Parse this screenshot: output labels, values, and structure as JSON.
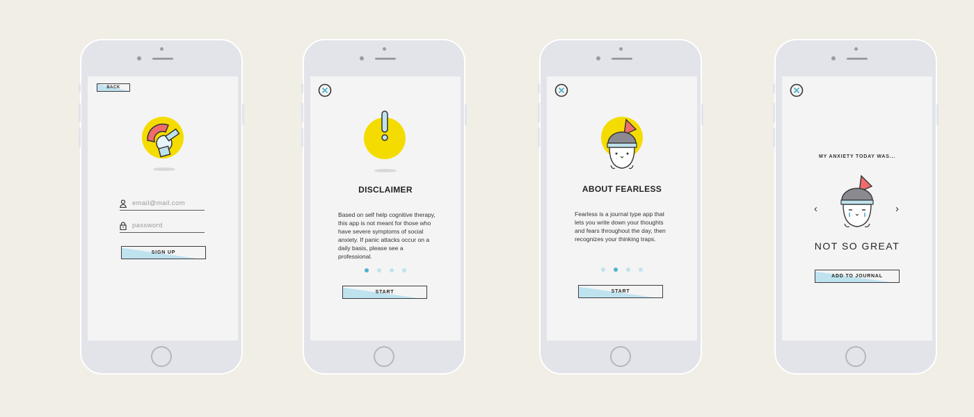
{
  "screens": [
    {
      "id": "login",
      "back_label": "BACK",
      "email_placeholder": "email@mail.com",
      "password_placeholder": "password",
      "signup_label": "SIGN UP"
    },
    {
      "id": "disclaimer",
      "title": "DISCLAIMER",
      "body": "Based on self help cognitive therapy, this app is not meant for those who have severe symptoms of social anxiety. If panic attacks occur on a daily basis, please see a professional.",
      "start_label": "START",
      "pager": {
        "count": 4,
        "active": 0
      }
    },
    {
      "id": "about",
      "title": "ABOUT FEARLESS",
      "body": "Fearless is a journal type app that lets you write down your thoughts and fears throughout the day, then recognizes  your thinking traps.",
      "start_label": "START",
      "pager": {
        "count": 4,
        "active": 1
      }
    },
    {
      "id": "mood",
      "prompt": "MY ANXIETY TODAY WAS...",
      "value": "NOT SO GREAT",
      "prev_glyph": "‹",
      "next_glyph": "›",
      "add_label": "ADD TO JOURNAL"
    }
  ],
  "icons": {
    "close": "close-icon",
    "user": "user-icon",
    "lock": "lock-icon",
    "helmet": "helmet-icon",
    "exclamation": "exclamation-icon",
    "mascot": "mascot-icon"
  },
  "colors": {
    "background": "#f0eee5",
    "phone": "#e2e4ea",
    "screen": "#f4f4f4",
    "accent_yellow": "#f5dc00",
    "accent_blue": "#bfe3ee",
    "accent_blue_dark": "#4fb1cc",
    "helmet_red": "#ef6c6c",
    "helmet_grey": "#8a8a90"
  }
}
